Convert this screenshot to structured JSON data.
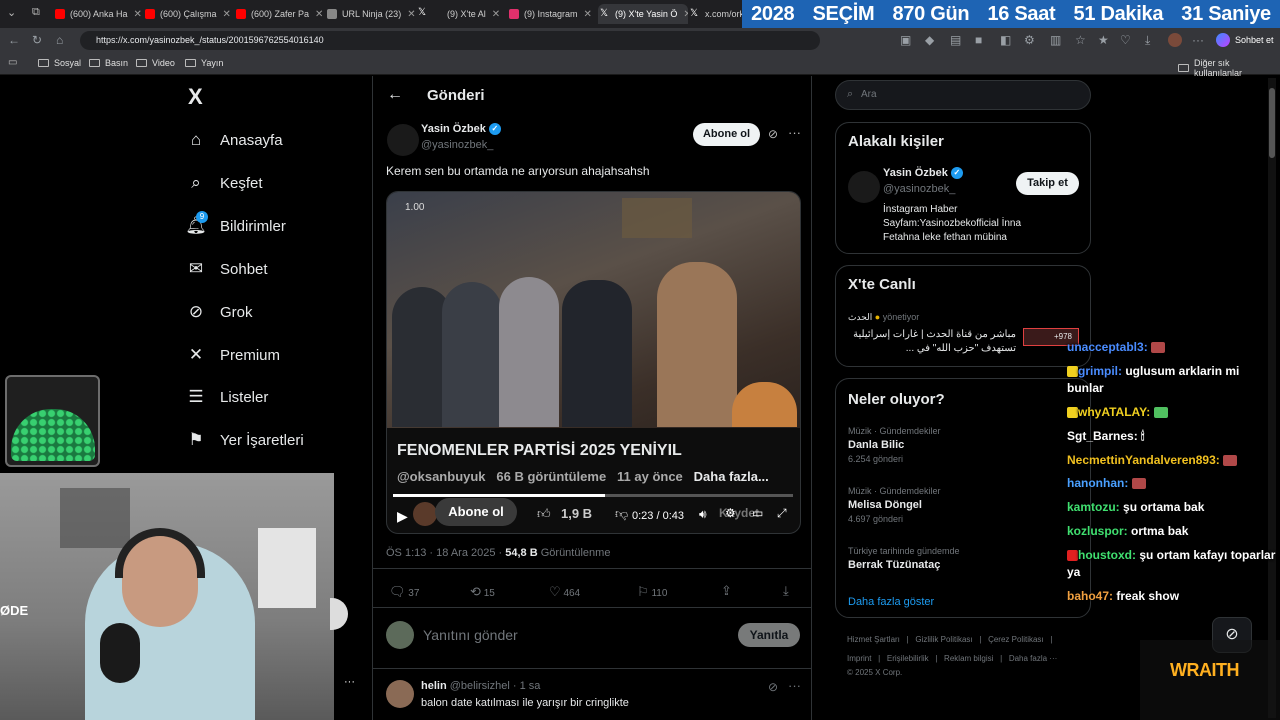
{
  "browser": {
    "tabs": [
      {
        "title": "(600) Anka Ha",
        "color": "#ff0000"
      },
      {
        "title": "(600) Çalışma",
        "color": "#ff0000"
      },
      {
        "title": "(600) Zafer Pa",
        "color": "#ff0000"
      },
      {
        "title": "URL Ninja (23)",
        "color": "#888888"
      },
      {
        "title": "(9) X'te Al",
        "color": "#555555"
      },
      {
        "title": "(9) Instagram",
        "color": "#e1306c"
      },
      {
        "title": "(9) X'te Yasin Ö",
        "color": "#555555"
      },
      {
        "title": "x.com/ork",
        "color": "#555555"
      }
    ],
    "url": "https://x.com/yasinozbek_/status/2001596762554016140",
    "chat_button": "Sohbet et",
    "bookmarks": [
      "Sosyal",
      "Basın",
      "Video",
      "Yayın"
    ],
    "other_bookmarks": "Diğer sık kullanılanlar"
  },
  "countdown": {
    "year": "2028",
    "label": "SEÇİM",
    "days": "870 Gün",
    "hours": "16 Saat",
    "minutes": "51 Dakika",
    "seconds": "31 Saniye"
  },
  "nav": {
    "logo": "X",
    "items": [
      "Anasayfa",
      "Keşfet",
      "Bildirimler",
      "Sohbet",
      "Grok",
      "Premium",
      "Listeler",
      "Yer İşaretleri"
    ],
    "notif_count": "9"
  },
  "post": {
    "header": "Gönderi",
    "author_name": "Yasin Özbek",
    "author_handle": "@yasinozbek_",
    "subscribe": "Abone ol",
    "text": "Kerem sen bu ortamda ne arıyorsun ahajahsahsh",
    "video": {
      "speed": "1.00",
      "title": "FENOMENLER PARTİSİ 2025 YENİYIL",
      "channel": "@oksanbuyuk",
      "views": "66 B görüntüleme",
      "ago": "11 ay önce",
      "more": "Daha fazla...",
      "subscribe": "Abone ol",
      "likes": "1,9 B",
      "time": "0:23 / 0:43",
      "progress": 0.53,
      "save": "Kaydet"
    },
    "timestamp": "ÖS 1:13 · 18 Ara 2025 · ",
    "views_count": "54,8 B",
    "views_label": " Görüntülenme",
    "stats": {
      "replies": "37",
      "reposts": "15",
      "likes": "464",
      "bookmarks": "110"
    },
    "reply_placeholder": "Yanıtını gönder",
    "reply_button": "Yanıtla"
  },
  "reply": {
    "name": "helin",
    "handle": "@belirsizhel · 1 sa",
    "text": "balon date katılması ile yarışır bir cringlikte"
  },
  "sidebar": {
    "search_placeholder": "Ara",
    "related_title": "Alakalı kişiler",
    "related_name": "Yasin Özbek",
    "related_handle": "@yasinozbek_",
    "follow": "Takip et",
    "related_bio": "İnstagram Haber Sayfam:Yasinozbekofficial İnna Fetahna leke fethan mübina",
    "live_title": "X'te Canlı",
    "live_host": "الحدث",
    "live_host_suffix": "yönetiyor",
    "live_text": "مباشر من قناة الحدث | غارات إسرائيلية تستهدف \"حزب الله\" في ...",
    "live_count": "+978",
    "trends_title": "Neler oluyor?",
    "trends": [
      {
        "category": "Müzik · Gündemdekiler",
        "name": "Danla Bilic",
        "count": "6.254 gönderi"
      },
      {
        "category": "Müzik · Gündemdekiler",
        "name": "Melisa Döngel",
        "count": "4.697 gönderi"
      },
      {
        "category": "Türkiye tarihinde gündemde",
        "name": "Berrak Tüzünataç",
        "count": ""
      }
    ],
    "show_more": "Daha fazla göster",
    "footer1": "Hizmet Şartları   |   Gizlilik Politikası   |   Çerez Politikası   |",
    "footer2": "Imprint   |   Erişilebilirlik   |   Reklam bilgisi   |   Daha fazla ···",
    "footer3": "© 2025 X Corp."
  },
  "chat": [
    {
      "user": "unacceptabl3:",
      "color": "#4a8cff",
      "msg": ""
    },
    {
      "user": "grimpil:",
      "color": "#4a8cff",
      "msg": "uglusum arklarin mi bunlar"
    },
    {
      "user": "whyATALAY:",
      "color": "#f0d020",
      "msg": ""
    },
    {
      "user": "Sgt_Barnes:",
      "color": "#ffffff",
      "msg": "🕯"
    },
    {
      "user": "NecmettinYandalveren893:",
      "color": "#f0c020",
      "msg": ""
    },
    {
      "user": "hanonhan:",
      "color": "#4aa0ff",
      "msg": ""
    },
    {
      "user": "kamtozu:",
      "color": "#40e070",
      "msg": "şu ortama bak"
    },
    {
      "user": "kozluspor:",
      "color": "#40e070",
      "msg": "ortma bak"
    },
    {
      "user": "houstoxd:",
      "color": "#40e070",
      "msg": "şu ortam kafayı toparlar ya"
    },
    {
      "user": "baho47:",
      "color": "#f0a040",
      "msg": "freak show"
    }
  ],
  "overlay_brand": "WRAITH",
  "overlay_text": "ØDE"
}
